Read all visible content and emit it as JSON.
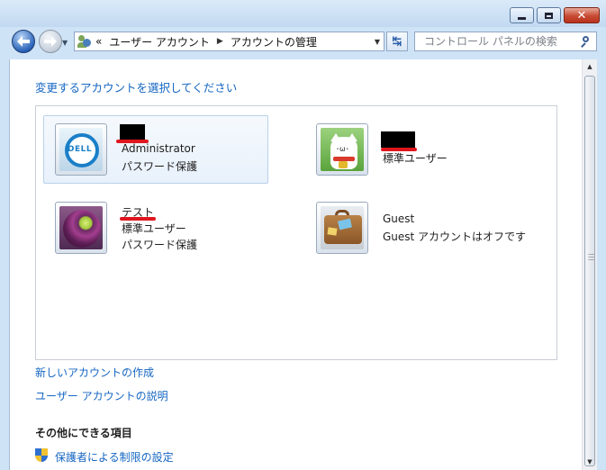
{
  "address_bar": {
    "overflow": "«",
    "crumbs": [
      "ユーザー アカウント",
      "アカウントの管理"
    ]
  },
  "search": {
    "placeholder": "コントロール パネルの検索"
  },
  "page": {
    "heading": "変更するアカウントを選択してください",
    "accounts": [
      {
        "name": "",
        "type": "Administrator",
        "status": "パスワード保護",
        "avatar": "dell-logo-icon",
        "selected": true
      },
      {
        "name": "",
        "type": "標準ユーザー",
        "status": "",
        "avatar": "lucky-cat-icon",
        "selected": false
      },
      {
        "name": "テスト",
        "type": "標準ユーザー",
        "status": "パスワード保護",
        "avatar": "purple-ball-icon",
        "selected": false
      },
      {
        "name": "Guest",
        "type": "Guest アカウントはオフです",
        "status": "",
        "avatar": "suitcase-icon",
        "selected": false
      }
    ],
    "create_link": "新しいアカウントの作成",
    "about_link": "ユーザー アカウントの説明",
    "more_heading": "その他にできる項目",
    "parental_link": "保護者による制限の設定"
  },
  "colors": {
    "link": "#1566c2",
    "redaction": "#000000",
    "redline": "#e0161e"
  }
}
